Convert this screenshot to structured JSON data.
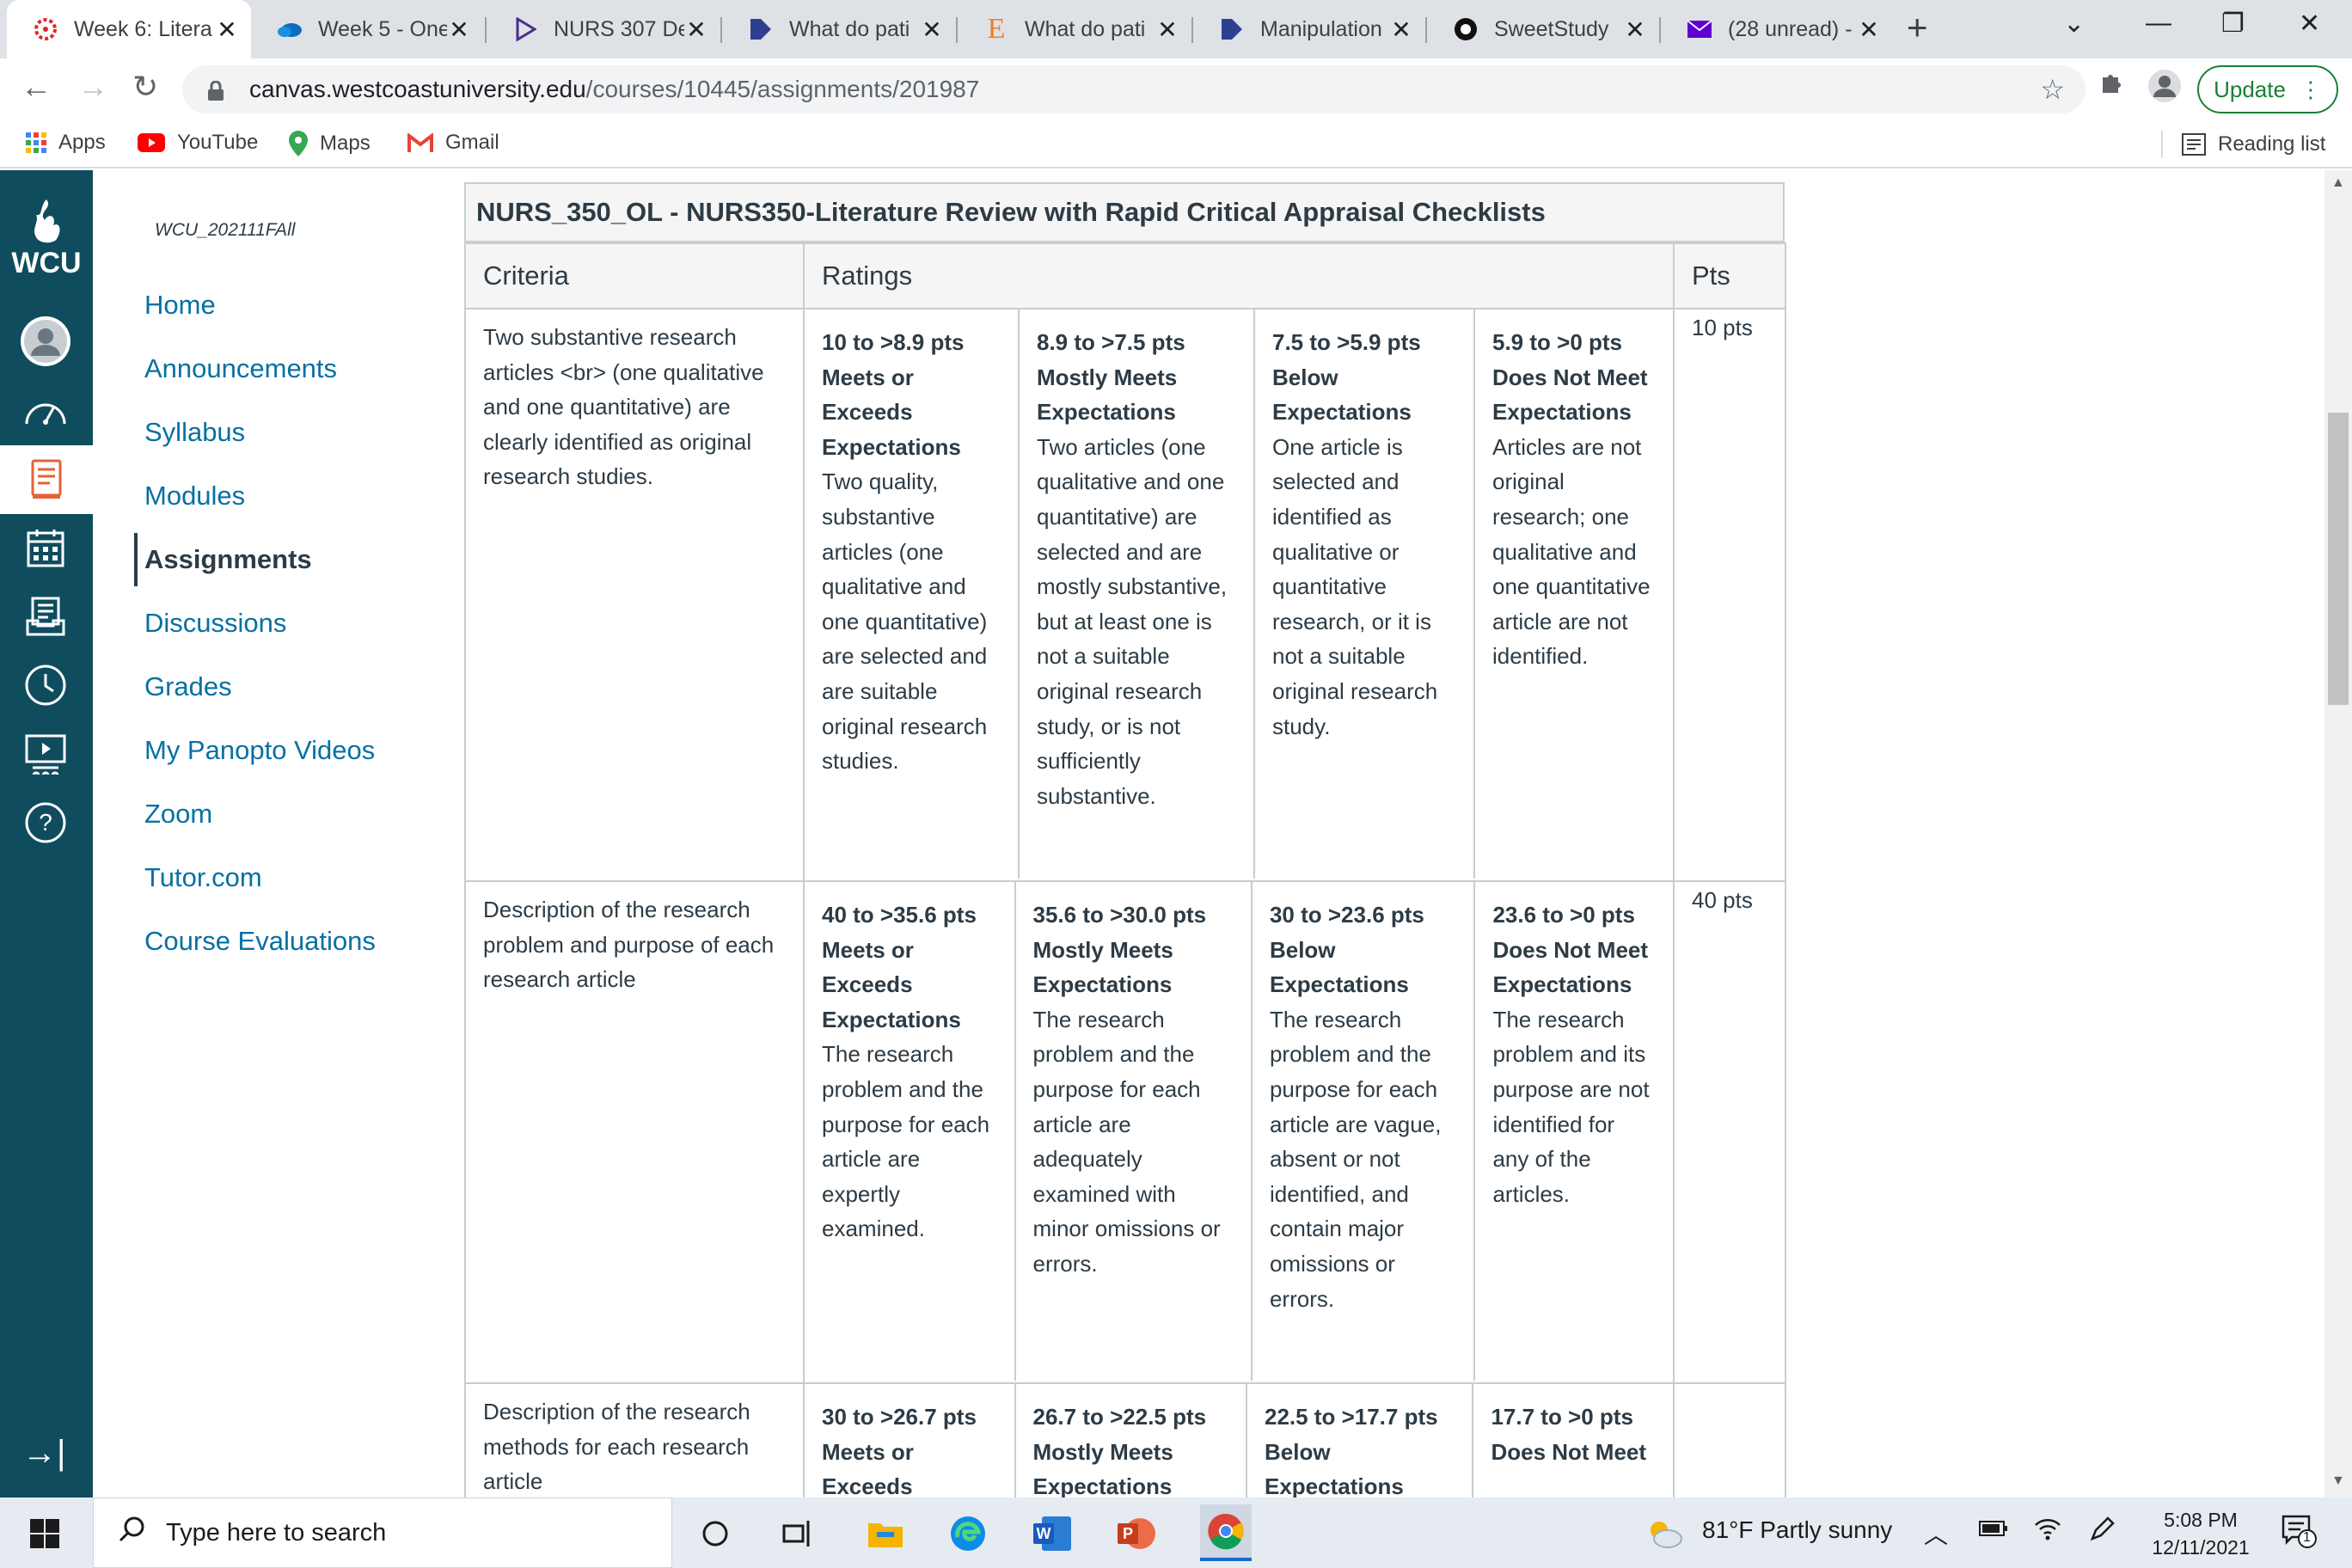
{
  "browser": {
    "tabs": [
      {
        "title": "Week 6: Litera",
        "active": true
      },
      {
        "title": "Week 5 - One"
      },
      {
        "title": "NURS 307 De"
      },
      {
        "title": "What do pati"
      },
      {
        "title": "What do pati"
      },
      {
        "title": "Manipulation"
      },
      {
        "title": "SweetStudy"
      },
      {
        "title": "(28 unread) -"
      }
    ],
    "url_host": "canvas.westcoastuniversity.edu",
    "url_path": "/courses/10445/assignments/201987",
    "update_label": "Update",
    "bookmarks": [
      {
        "label": "Apps"
      },
      {
        "label": "YouTube"
      },
      {
        "label": "Maps"
      },
      {
        "label": "Gmail"
      }
    ],
    "reading_list": "Reading list"
  },
  "global_nav": {
    "logo_text": "WCU"
  },
  "course_nav": {
    "breadcrumb": "WCU_202111FAll",
    "items": [
      {
        "label": "Home"
      },
      {
        "label": "Announcements"
      },
      {
        "label": "Syllabus"
      },
      {
        "label": "Modules"
      },
      {
        "label": "Assignments",
        "active": true
      },
      {
        "label": "Discussions"
      },
      {
        "label": "Grades"
      },
      {
        "label": "My Panopto Videos"
      },
      {
        "label": "Zoom"
      },
      {
        "label": "Tutor.com"
      },
      {
        "label": "Course Evaluations"
      }
    ]
  },
  "rubric": {
    "title": "NURS_350_OL - NURS350-Literature Review with Rapid Critical Appraisal Checklists",
    "headers": {
      "criteria": "Criteria",
      "ratings": "Ratings",
      "pts": "Pts"
    },
    "rows": [
      {
        "criterion": "Two substantive research articles <br> (one qualitative and one quantitative) are clearly identified as original research studies.",
        "points": "10 pts",
        "ratings": [
          {
            "pts": "10 to >8.9 pts",
            "label": "Meets or Exceeds Expectations",
            "desc": "Two quality, substantive articles (one qualitative and one quantitative) are selected and are suitable original research studies."
          },
          {
            "pts": "8.9 to >7.5 pts",
            "label": "Mostly Meets Expectations",
            "desc": "Two articles (one qualitative and one quantitative) are selected and are mostly substantive, but at least one is not a suitable original research study, or is not sufficiently substantive."
          },
          {
            "pts": "7.5 to >5.9 pts",
            "label": "Below Expectations",
            "desc": "One article is selected and identified as qualitative or quantitative research, or it is not a suitable original research study."
          },
          {
            "pts": "5.9 to >0 pts",
            "label": "Does Not Meet Expectations",
            "desc": "Articles are not original research; one qualitative and one quantitative article are not identified."
          }
        ]
      },
      {
        "criterion": "Description of the research problem and purpose of each research article",
        "points": "40 pts",
        "ratings": [
          {
            "pts": "40 to >35.6 pts",
            "label": "Meets or Exceeds Expectations",
            "desc": "The research problem and the purpose for each article are expertly examined."
          },
          {
            "pts": "35.6 to >30.0 pts",
            "label": "Mostly Meets Expectations",
            "desc": "The research problem and the purpose for each article are adequately examined with minor omissions or errors."
          },
          {
            "pts": "30 to >23.6 pts",
            "label": "Below Expectations",
            "desc": "The research problem and the purpose for each article are vague, absent or not identified, and contain major omissions or errors."
          },
          {
            "pts": "23.6 to >0 pts",
            "label": "Does Not Meet Expectations",
            "desc": "The research problem and its purpose are not identified for any of the articles."
          }
        ]
      },
      {
        "criterion": "Description of the research methods for each research article",
        "points": "",
        "ratings": [
          {
            "pts": "30 to >26.7 pts",
            "label": "Meets or Exceeds",
            "desc": ""
          },
          {
            "pts": "26.7 to >22.5 pts",
            "label": "Mostly Meets Expectations",
            "desc": ""
          },
          {
            "pts": "22.5 to >17.7 pts",
            "label": "Below Expectations",
            "desc": ""
          },
          {
            "pts": "17.7 to >0 pts",
            "label": "Does Not Meet",
            "desc": ""
          }
        ]
      }
    ]
  },
  "taskbar": {
    "search_placeholder": "Type here to search",
    "weather": "81°F  Partly sunny",
    "time": "5:08 PM",
    "date": "12/11/2021",
    "notification_count": "1"
  }
}
